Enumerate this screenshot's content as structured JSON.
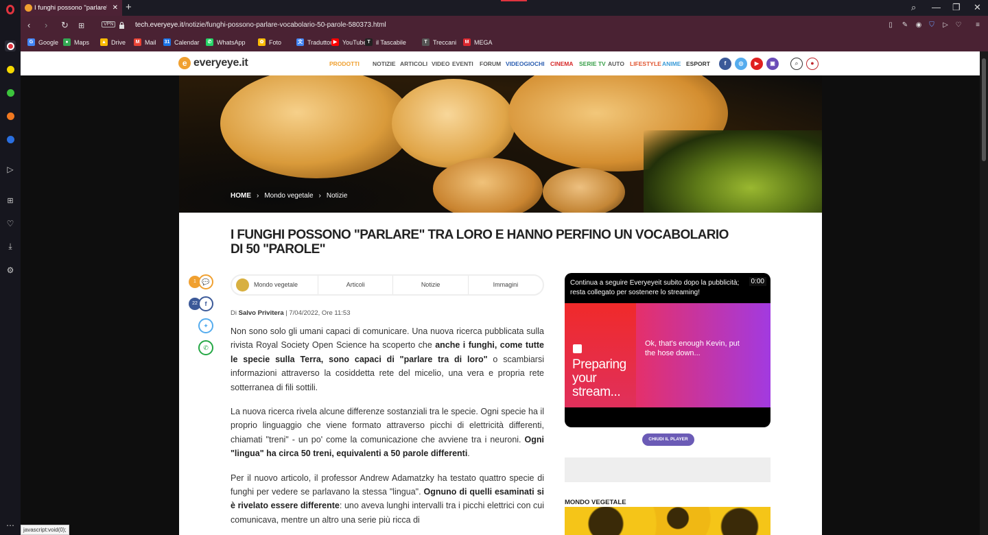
{
  "tab": {
    "title": "I funghi possono \"parlare\"",
    "close": "✕",
    "new_tab": "+"
  },
  "window": {
    "search": "⌕",
    "minimize": "—",
    "restore": "❐",
    "close": "✕"
  },
  "address_bar": {
    "back": "‹",
    "forward": "›",
    "reload": "↻",
    "vpn": "VPN",
    "url_host": "tech.everyeye.it",
    "url_path": "/notizie/funghi-possono-parlare-vocabolario-50-parole-580373.html"
  },
  "bookmarks": [
    {
      "label": "Google",
      "color": "#4285f4",
      "glyph": "G"
    },
    {
      "label": "Maps",
      "color": "#34a853",
      "glyph": "●"
    },
    {
      "label": "Drive",
      "color": "#fbbc04",
      "glyph": "▲"
    },
    {
      "label": "Mail",
      "color": "#ea4335",
      "glyph": "M"
    },
    {
      "label": "Calendar",
      "color": "#1a73e8",
      "glyph": "31"
    },
    {
      "label": "WhatsApp",
      "color": "#25d366",
      "glyph": "✆"
    },
    {
      "label": "Foto",
      "color": "#fbbc04",
      "glyph": "✿"
    },
    {
      "label": "Traduttore",
      "color": "#4285f4",
      "glyph": "文"
    },
    {
      "label": "YouTube",
      "color": "#ff0000",
      "glyph": "▶"
    },
    {
      "label": "il Tascabile",
      "color": "#222222",
      "glyph": "T"
    },
    {
      "label": "Treccani",
      "color": "#555555",
      "glyph": "T"
    },
    {
      "label": "MEGA",
      "color": "#d9272e",
      "glyph": "M"
    }
  ],
  "site": {
    "logo": "everyeye.it",
    "nav": [
      {
        "label": "PRODOTTI",
        "color": "#f0a030"
      },
      {
        "label": "NOTIZIE",
        "color": "#555555"
      },
      {
        "label": "ARTICOLI",
        "color": "#555555"
      },
      {
        "label": "VIDEO",
        "color": "#555555"
      },
      {
        "label": "EVENTI",
        "color": "#555555"
      },
      {
        "label": "FORUM",
        "color": "#555555"
      },
      {
        "label": "VIDEOGIOCHI",
        "color": "#2a5db0"
      },
      {
        "label": "CINEMA",
        "color": "#d62828"
      },
      {
        "label": "SERIE TV",
        "color": "#3aa04a"
      },
      {
        "label": "AUTO",
        "color": "#555555"
      },
      {
        "label": "LIFESTYLE",
        "color": "#e05530"
      },
      {
        "label": "ANIME",
        "color": "#3a9bd8"
      },
      {
        "label": "ESPORT",
        "color": "#333333"
      }
    ]
  },
  "breadcrumb": {
    "home": "HOME",
    "sep": "›",
    "section": "Mondo vegetale",
    "sub": "Notizie"
  },
  "article": {
    "title": "I FUNGHI POSSONO \"PARLARE\" TRA LORO E HANNO PERFINO UN VOCABOLARIO DI 50 \"PAROLE\"",
    "comments_count": "1",
    "facebook_count": "22",
    "tabs": [
      "Mondo vegetale",
      "Articoli",
      "Notizie",
      "Immagini"
    ],
    "by_prefix": "Di",
    "author": "Salvo Privitera",
    "date": "| 7/04/2022, Ore 11:53",
    "p1_a": "Non sono solo gli umani capaci di comunicare. Una nuova ricerca pubblicata sulla rivista Royal Society Open Science ha scoperto che ",
    "p1_b": "anche i funghi, come tutte le specie sulla Terra, sono capaci di \"parlare tra di loro\"",
    "p1_c": " o scambiarsi informazioni attraverso la cosiddetta rete del micelio, una vera e propria rete sotterranea di fili sottili.",
    "p2_a": "La nuova ricerca rivela alcune differenze sostanziali tra le specie. Ogni specie ha il proprio linguaggio che viene formato attraverso picchi di elettricità differenti, chiamati \"treni\" - un po' come la comunicazione che avviene tra i neuroni. ",
    "p2_b": "Ogni \"lingua\" ha circa 50 treni, equivalenti a 50 parole differenti",
    "p2_c": ".",
    "p3_a": "Per il nuovo articolo, il professor Andrew Adamatzky ha testato quattro specie di funghi per vedere se parlavano la stessa \"lingua\". ",
    "p3_b": "Ognuno di quelli esaminati si è rivelato essere differente",
    "p3_c": ": uno aveva lunghi intervalli tra i picchi elettrici con cui comunicava, mentre un altro una serie più ricca di"
  },
  "player": {
    "message": "Continua a seguire Everyeyeit subito dopo la pubblicità; resta collegato per sostenere lo streaming!",
    "time": "0:00",
    "preparing": "Preparing your stream...",
    "kevin": "Ok, that's enough Kevin, put the hose down...",
    "close_label": "CHIUDI IL PLAYER"
  },
  "sidebar_section": "MONDO VEGETALE",
  "status_bar": "javascript:void(0);"
}
